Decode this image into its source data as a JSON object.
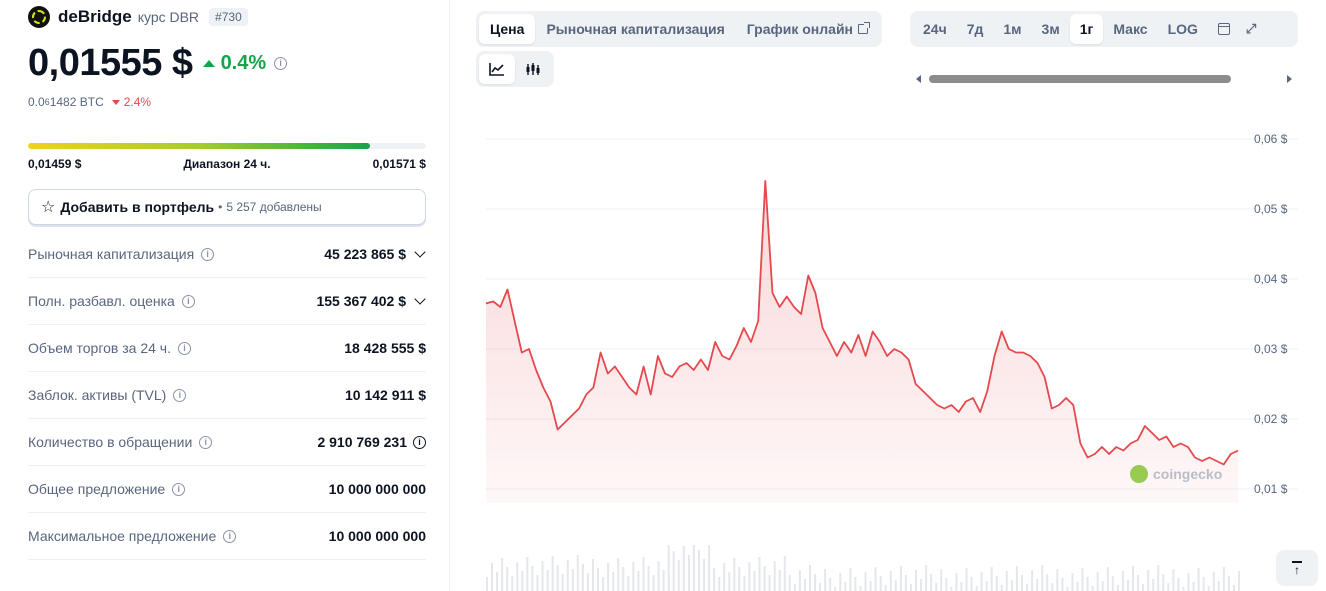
{
  "coin": {
    "name": "deBridge",
    "subtitle": "курс DBR",
    "rank": "#730"
  },
  "price": {
    "value": "0,01555 $",
    "change_24h": "0.4%",
    "btc_prefix": "0.0",
    "btc_sub": "6",
    "btc_rest": "1482 BTC",
    "btc_change": "2.4%"
  },
  "range_24h": {
    "low": "0,01459 $",
    "label": "Диапазон 24 ч.",
    "high": "0,01571 $",
    "position": 0.86
  },
  "portfolio": {
    "label": "Добавить в портфель",
    "separator": "•",
    "added": "5 257 добавлены"
  },
  "stats": [
    {
      "label": "Рыночная капитализация",
      "value": "45 223 865 $"
    },
    {
      "label": "Полн. разбавл. оценка",
      "value": "155 367 402 $"
    },
    {
      "label": "Объем торгов за 24 ч.",
      "value": "18 428 555 $"
    },
    {
      "label": "Заблок. активы (TVL)",
      "value": "10 142 911 $"
    },
    {
      "label": "Количество в обращении",
      "value": "2 910 769 231"
    },
    {
      "label": "Общее предложение",
      "value": "10 000 000 000"
    },
    {
      "label": "Максимальное предложение",
      "value": "10 000 000 000"
    }
  ],
  "chart_tabs": {
    "price": "Цена",
    "market_cap": "Рыночная капитализация",
    "live_chart": "График онлайн"
  },
  "range_tabs": {
    "d24": "24ч",
    "d7": "7д",
    "m1": "1м",
    "m3": "3м",
    "y1": "1г",
    "max": "Макс",
    "log": "LOG"
  },
  "watermark": "coingecko",
  "colors": {
    "up": "#16a34a",
    "down": "#e5484d",
    "line": "#e5484d"
  },
  "chart_data": {
    "type": "area",
    "ylim": [
      0.008,
      0.062
    ],
    "y_ticks": [
      "0,06 $",
      "0,05 $",
      "0,04 $",
      "0,03 $",
      "0,02 $",
      "0,01 $"
    ],
    "y_tick_values": [
      0.06,
      0.05,
      0.04,
      0.03,
      0.02,
      0.01
    ],
    "values": [
      0.0365,
      0.0368,
      0.036,
      0.0385,
      0.034,
      0.0295,
      0.03,
      0.027,
      0.0245,
      0.0225,
      0.0185,
      0.0195,
      0.0205,
      0.0215,
      0.0235,
      0.0245,
      0.0295,
      0.0265,
      0.0275,
      0.026,
      0.0245,
      0.0235,
      0.0275,
      0.0235,
      0.029,
      0.0265,
      0.026,
      0.0275,
      0.028,
      0.027,
      0.0285,
      0.027,
      0.031,
      0.029,
      0.0285,
      0.0305,
      0.033,
      0.031,
      0.034,
      0.054,
      0.038,
      0.036,
      0.0375,
      0.036,
      0.035,
      0.0405,
      0.038,
      0.033,
      0.031,
      0.029,
      0.031,
      0.0295,
      0.032,
      0.029,
      0.0325,
      0.031,
      0.029,
      0.03,
      0.0295,
      0.0285,
      0.025,
      0.024,
      0.023,
      0.022,
      0.0215,
      0.022,
      0.021,
      0.0225,
      0.023,
      0.021,
      0.024,
      0.029,
      0.0325,
      0.03,
      0.0295,
      0.0295,
      0.029,
      0.028,
      0.026,
      0.0215,
      0.022,
      0.023,
      0.022,
      0.0165,
      0.0145,
      0.015,
      0.016,
      0.015,
      0.016,
      0.0155,
      0.0165,
      0.017,
      0.019,
      0.018,
      0.017,
      0.0175,
      0.016,
      0.0165,
      0.016,
      0.0145,
      0.014,
      0.0145,
      0.014,
      0.0135,
      0.015,
      0.0155
    ]
  }
}
